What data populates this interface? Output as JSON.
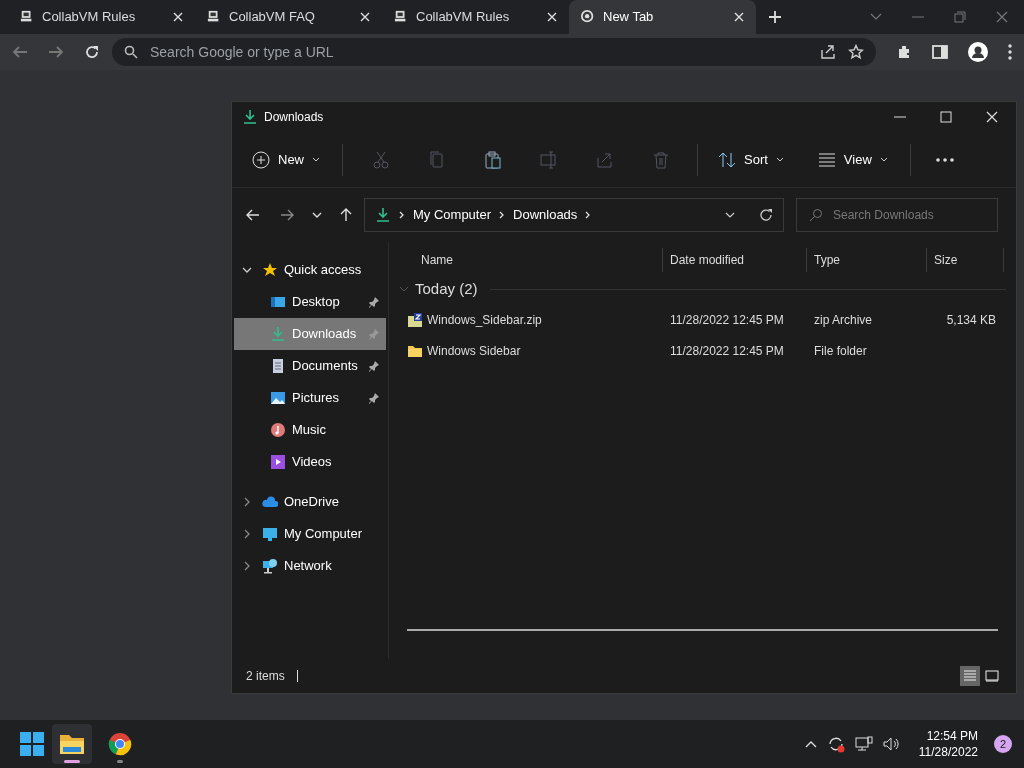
{
  "browser": {
    "tabs": [
      {
        "title": "CollabVM Rules",
        "kind": "site",
        "selected": false
      },
      {
        "title": "CollabVM FAQ",
        "kind": "site",
        "selected": false
      },
      {
        "title": "CollabVM Rules",
        "kind": "site",
        "selected": false
      },
      {
        "title": "New Tab",
        "kind": "newtab",
        "selected": true
      }
    ],
    "address": {
      "placeholder": "Search Google or type a URL"
    }
  },
  "explorer": {
    "title": "Downloads",
    "toolbar": {
      "new": "New",
      "sort": "Sort",
      "view": "View"
    },
    "breadcrumb": [
      "My Computer",
      "Downloads"
    ],
    "search": {
      "placeholder": "Search Downloads"
    },
    "sidebar": [
      {
        "label": "Quick access",
        "kind": "star",
        "expanded": true,
        "selected": false,
        "children": [
          {
            "label": "Desktop",
            "kind": "desktop",
            "pinned": true,
            "selected": false
          },
          {
            "label": "Downloads",
            "kind": "download",
            "pinned": true,
            "selected": true
          },
          {
            "label": "Documents",
            "kind": "document",
            "pinned": true,
            "selected": false
          },
          {
            "label": "Pictures",
            "kind": "pictures",
            "pinned": true,
            "selected": false
          },
          {
            "label": "Music",
            "kind": "music",
            "pinned": false,
            "selected": false
          },
          {
            "label": "Videos",
            "kind": "videos",
            "pinned": false,
            "selected": false
          }
        ]
      },
      {
        "label": "OneDrive",
        "kind": "cloud",
        "expanded": false,
        "selected": false
      },
      {
        "label": "My Computer",
        "kind": "computer",
        "expanded": false,
        "selected": false
      },
      {
        "label": "Network",
        "kind": "network",
        "expanded": false,
        "selected": false
      }
    ],
    "columns": [
      "Name",
      "Date modified",
      "Type",
      "Size"
    ],
    "group": {
      "label": "Today (2)",
      "expanded": true
    },
    "files": [
      {
        "name": "Windows_Sidebar.zip",
        "kind": "zip",
        "date": "11/28/2022 12:45 PM",
        "type": "zip Archive",
        "size": "5,134 KB"
      },
      {
        "name": "Windows Sidebar",
        "kind": "folder",
        "date": "11/28/2022 12:45 PM",
        "type": "File folder"
      }
    ],
    "status": "2 items",
    "view_modes": [
      {
        "kind": "details",
        "selected": true
      },
      {
        "kind": "tiles",
        "selected": false
      }
    ]
  },
  "taskbar": {
    "apps": [
      {
        "kind": "explorer",
        "active": true
      },
      {
        "kind": "chrome",
        "active": false
      }
    ],
    "time": "12:54 PM",
    "date": "11/28/2022",
    "notifications": "2"
  }
}
